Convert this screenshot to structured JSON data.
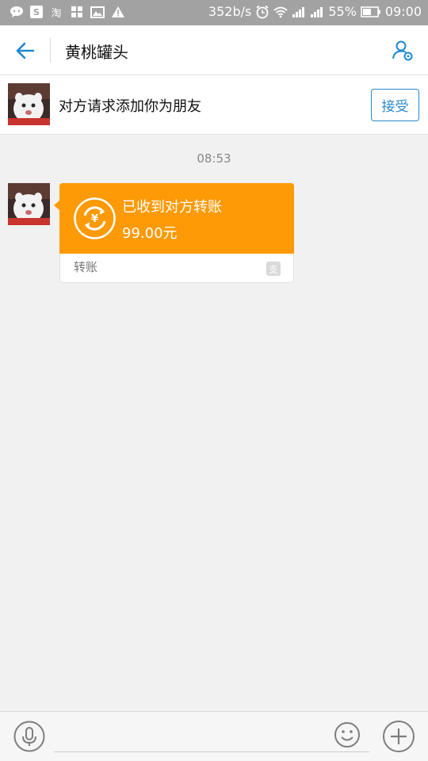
{
  "status_bar": {
    "network_speed": "352b/s",
    "battery": "55%",
    "time": "09:00",
    "taobao_glyph": "淘"
  },
  "header": {
    "title": "黄桃罐头",
    "back_icon": "arrow-left-icon",
    "profile_icon": "user-settings-icon"
  },
  "friend_request": {
    "text": "对方请求添加你为朋友",
    "accept_label": "接受"
  },
  "timestamp": "08:53",
  "transfer_message": {
    "title": "已收到对方转账",
    "amount": "99.00元",
    "footer": "转账",
    "badge_glyph": "支",
    "accent_color": "#fe9a06"
  },
  "input_bar": {
    "mic_icon": "microphone-icon",
    "emoji_icon": "smiley-icon",
    "plus_icon": "plus-icon",
    "value": ""
  }
}
